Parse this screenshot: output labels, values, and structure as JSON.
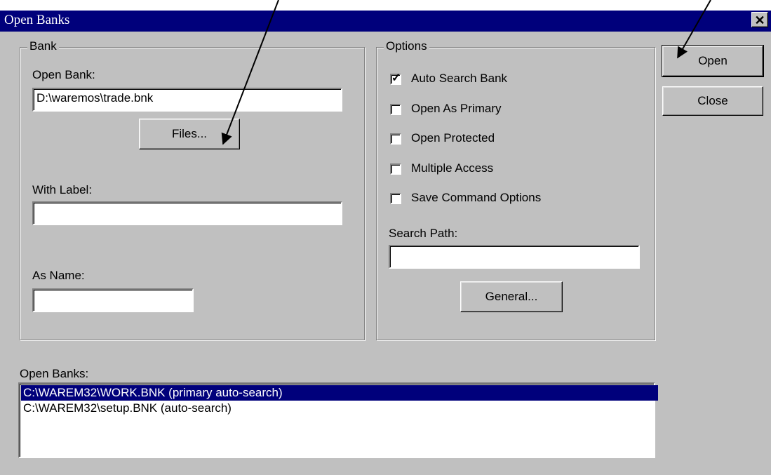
{
  "window": {
    "title": "Open Banks",
    "close_glyph": "✕"
  },
  "bank_group": {
    "label": "Bank",
    "open_bank_label": "Open Bank:",
    "open_bank_value": "D:\\waremos\\trade.bnk",
    "files_button": "Files...",
    "with_label_label": "With Label:",
    "with_label_value": "",
    "as_name_label": "As Name:",
    "as_name_value": ""
  },
  "options_group": {
    "label": "Options",
    "checkboxes": [
      {
        "label": "Auto Search Bank",
        "checked": true
      },
      {
        "label": "Open As Primary",
        "checked": false
      },
      {
        "label": "Open Protected",
        "checked": false
      },
      {
        "label": "Multiple Access",
        "checked": false
      },
      {
        "label": "Save Command Options",
        "checked": false
      }
    ],
    "search_path_label": "Search Path:",
    "search_path_value": "",
    "general_button": "General..."
  },
  "actions": {
    "open_button": "Open",
    "close_button": "Close"
  },
  "open_banks": {
    "label": "Open Banks:",
    "items": [
      "C:\\WAREM32\\WORK.BNK (primary auto-search)",
      "C:\\WAREM32\\setup.BNK (auto-search)"
    ],
    "selected_index": 0
  },
  "checkmark_glyph": "✓",
  "colors": {
    "titlebar": "#00007b",
    "dialog": "#c0c0c0",
    "selection": "#00007b"
  }
}
